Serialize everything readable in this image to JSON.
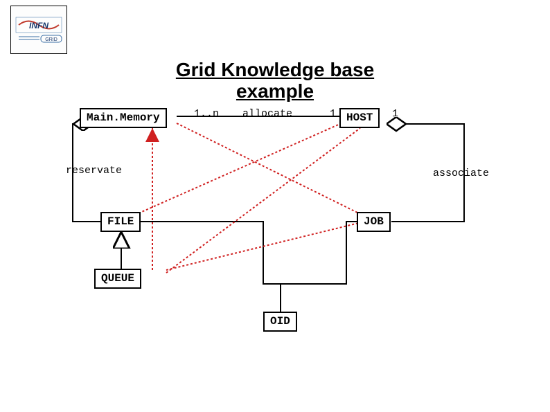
{
  "title_line1": "Grid Knowledge base",
  "title_line2": "example",
  "logo": {
    "text_top": "INFN",
    "text_bottom": "GRID"
  },
  "nodes": {
    "main_memory": "Main.Memory",
    "host": "HOST",
    "file": "FILE",
    "job": "JOB",
    "queue": "QUEUE",
    "oid": "OID"
  },
  "labels": {
    "mult_left": "1..n",
    "allocate": "allocate",
    "mult_right_a": "1",
    "mult_right_b": "1",
    "reservate": "reservate",
    "associate": "associate"
  },
  "diagram_meta": {
    "type": "UML-class-diagram",
    "entities": [
      "Main.Memory",
      "HOST",
      "FILE",
      "JOB",
      "QUEUE",
      "OID"
    ],
    "relationships": [
      {
        "from": "Main.Memory",
        "to": "HOST",
        "label": "allocate",
        "multiplicity_from": "1..n",
        "multiplicity_to": "1 1",
        "style": "solid"
      },
      {
        "from": "Main.Memory",
        "to": "FILE",
        "label": "reservate",
        "style": "solid-aggregation"
      },
      {
        "from": "HOST",
        "to": "JOB",
        "label": "associate",
        "style": "solid-aggregation"
      },
      {
        "from": "QUEUE",
        "to": "FILE",
        "label": "",
        "style": "generalization"
      },
      {
        "from": "FILE",
        "to": "JOB",
        "style": "solid"
      },
      {
        "from": "JOB",
        "to": "OID",
        "style": "solid"
      },
      {
        "from": "QUEUE",
        "to": "Main.Memory",
        "style": "dotted-depend"
      },
      {
        "from": "FILE",
        "to": "HOST",
        "style": "dotted"
      },
      {
        "from": "Main.Memory",
        "to": "JOB",
        "style": "dotted"
      },
      {
        "from": "QUEUE",
        "to": "JOB",
        "style": "dotted"
      },
      {
        "from": "QUEUE",
        "to": "HOST",
        "style": "dotted"
      }
    ]
  }
}
